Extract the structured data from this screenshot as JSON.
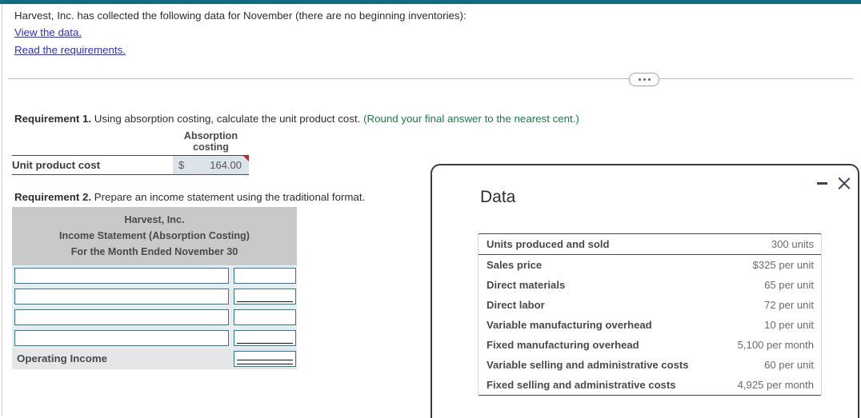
{
  "colors": {
    "accent_bar": "#106d84",
    "link": "#2a31c8",
    "hint_green": "#1f7a43",
    "input_border": "#2a7b91",
    "statement_header_bg": "#c9c9c9",
    "answer_cell_bg": "#dde3ea",
    "comment_flag": "#c62828"
  },
  "question": {
    "prompt": "Harvest, Inc. has collected the following data for November (there are no beginning inventories):",
    "link_data": "View the data.",
    "link_requirements": "Read the requirements."
  },
  "splitter": {
    "handle_icon": "ellipsis-icon"
  },
  "requirement1": {
    "number": "Requirement 1.",
    "text": " Using absorption costing, calculate the unit product cost. ",
    "hint": "(Round your final answer to the nearest cent.)",
    "column_header_line1": "Absorption",
    "column_header_line2": "costing",
    "row_label": "Unit product cost",
    "currency_symbol": "$",
    "value": "164.00"
  },
  "requirement2": {
    "number": "Requirement 2.",
    "text": " Prepare an income statement using the traditional format.",
    "statement_header": {
      "company": "Harvest, Inc.",
      "title": "Income Statement (Absorption Costing)",
      "period": "For the Month Ended November 30"
    },
    "rows": [
      {
        "label": "",
        "value": "",
        "rule": "none"
      },
      {
        "label": "",
        "value": "",
        "rule": "single"
      },
      {
        "label": "",
        "value": "",
        "rule": "none"
      },
      {
        "label": "",
        "value": "",
        "rule": "single"
      }
    ],
    "total_row": {
      "label": "Operating Income",
      "value": "",
      "rule": "double"
    }
  },
  "data_panel": {
    "title": "Data",
    "minimize_label": "minimize-icon",
    "close_label": "close-icon",
    "rows": [
      {
        "label": "Units produced and sold",
        "value": "300 units"
      },
      {
        "label": "Sales price",
        "value": "$325 per unit"
      },
      {
        "label": "Direct materials",
        "value": "65 per unit"
      },
      {
        "label": "Direct labor",
        "value": "72 per unit"
      },
      {
        "label": "Variable manufacturing overhead",
        "value": "10 per unit"
      },
      {
        "label": "Fixed manufacturing overhead",
        "value": "5,100 per month"
      },
      {
        "label": "Variable selling and administrative costs",
        "value": "60 per unit"
      },
      {
        "label": "Fixed selling and administrative costs",
        "value": "4,925 per month"
      }
    ]
  }
}
